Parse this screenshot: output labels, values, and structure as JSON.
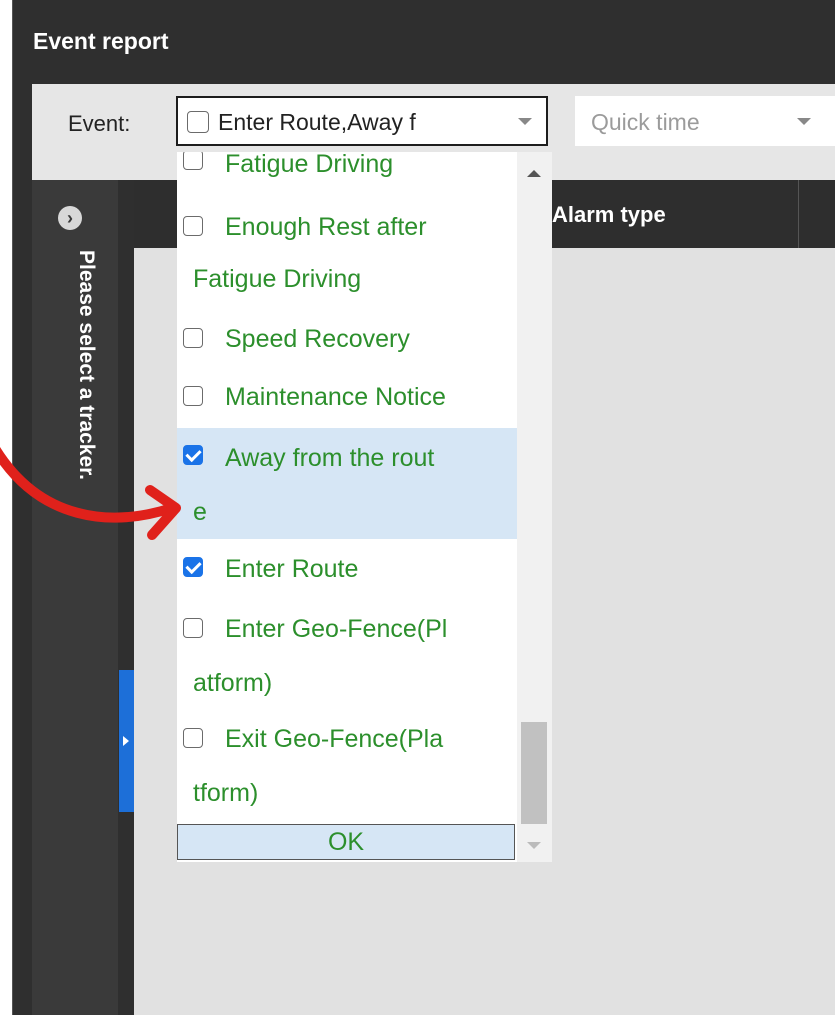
{
  "window": {
    "title": "Event report"
  },
  "toolbar": {
    "event_label": "Event:",
    "event_select_value": "Enter Route,Away f",
    "quick_time_placeholder": "Quick time"
  },
  "side_panel": {
    "message": "Please select a tracker."
  },
  "table": {
    "columns": [
      {
        "label": "Alarm type"
      }
    ]
  },
  "dropdown": {
    "items": [
      {
        "line1": "Fatigue Driving",
        "line2": "",
        "checked": false
      },
      {
        "line1": "Enough Rest after",
        "line2": "Fatigue Driving",
        "checked": false
      },
      {
        "line1": "Speed Recovery",
        "line2": "",
        "checked": false
      },
      {
        "line1": "Maintenance Notice",
        "line2": "",
        "checked": false
      },
      {
        "line1": "Away from the rout",
        "line2": "e",
        "checked": true
      },
      {
        "line1": "Enter Route",
        "line2": "",
        "checked": true
      },
      {
        "line1": "Enter Geo-Fence(Pl",
        "line2": "atform)",
        "checked": false
      },
      {
        "line1": "Exit Geo-Fence(Pla",
        "line2": "tform)",
        "checked": false
      }
    ],
    "ok_label": "OK"
  },
  "colors": {
    "accent": "#1a73e8",
    "item_text": "#2c8f2c",
    "selected_row": "#d6e6f5",
    "annotation_arrow": "#e0211b"
  }
}
